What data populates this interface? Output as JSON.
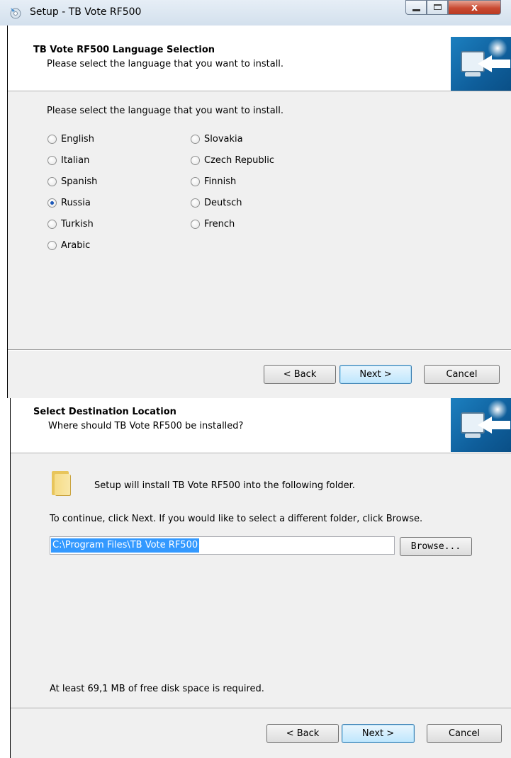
{
  "window1": {
    "title": "Setup - TB Vote RF500",
    "controls": {
      "close": "x"
    },
    "header": {
      "title": "TB Vote RF500 Language Selection",
      "subtitle": "Please select the language that you want to install."
    },
    "prompt": "Please select the language that you want to install.",
    "languages_left": [
      {
        "label": "English",
        "checked": false
      },
      {
        "label": "Italian",
        "checked": false
      },
      {
        "label": "Spanish",
        "checked": false
      },
      {
        "label": "Russia",
        "checked": true
      },
      {
        "label": "Turkish",
        "checked": false
      },
      {
        "label": "Arabic",
        "checked": false
      }
    ],
    "languages_right": [
      {
        "label": "Slovakia",
        "checked": false
      },
      {
        "label": "Czech Republic",
        "checked": false
      },
      {
        "label": "Finnish",
        "checked": false
      },
      {
        "label": "Deutsch",
        "checked": false
      },
      {
        "label": "French",
        "checked": false
      }
    ],
    "buttons": {
      "back": "< Back",
      "next": "Next >",
      "cancel": "Cancel"
    }
  },
  "window2": {
    "header": {
      "title": "Select Destination Location",
      "subtitle": "Where should TB Vote RF500 be installed?"
    },
    "info": "Setup will install TB Vote RF500 into the following folder.",
    "instruction": "To continue, click Next. If you would like to select a different folder, click Browse.",
    "path_value": "C:\\Program Files\\TB Vote RF500",
    "browse_label": "Browse...",
    "disk_space": "At least 69,1 MB of free disk space is required.",
    "buttons": {
      "back": "< Back",
      "next": "Next >",
      "cancel": "Cancel"
    }
  }
}
